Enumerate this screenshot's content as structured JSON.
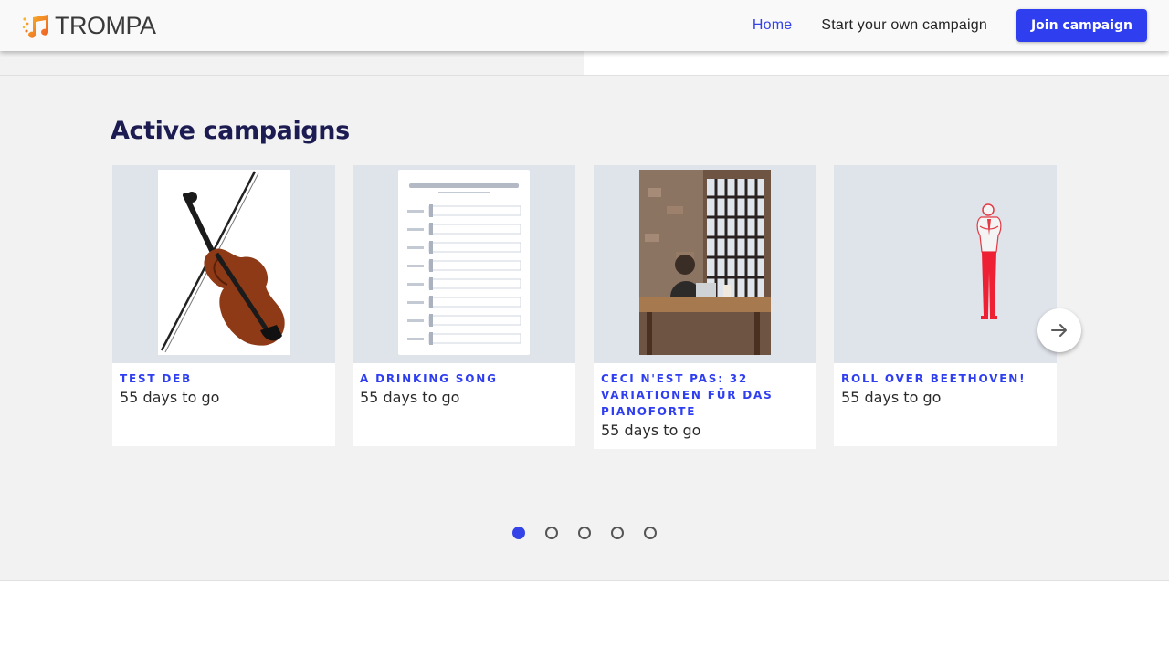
{
  "header": {
    "logo_text": "TROMPA",
    "nav": [
      {
        "label": "Home",
        "active": true
      },
      {
        "label": "Start your own campaign",
        "active": false
      }
    ],
    "join_button": "Join campaign",
    "accent_color": "#2f3ff0"
  },
  "campaigns": {
    "title": "Active campaigns",
    "cards": [
      {
        "title": "Test Deb",
        "subtitle": "55 days to go",
        "image": "violin-image"
      },
      {
        "title": "A drinking song",
        "subtitle": "55 days to go",
        "image": "sheet-music-image"
      },
      {
        "title": "Ceci n'est pas: 32 Variationen für das Pianoforte",
        "subtitle": "55 days to go",
        "image": "person-at-desk-photo"
      },
      {
        "title": "Roll over Beethoven!",
        "subtitle": "55 days to go",
        "image": "red-figure-illustration"
      }
    ],
    "next_icon": "arrow-right-icon",
    "pagination": {
      "pages": 5,
      "current": 1
    }
  }
}
